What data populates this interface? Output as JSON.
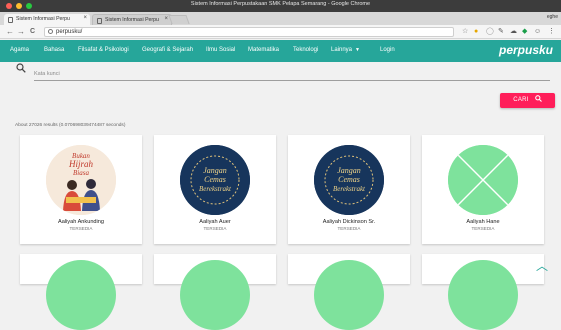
{
  "browser": {
    "window_title": "Sistem Informasi Perpustakaan SMK Pelapa Semarang - Google Chrome",
    "tabs": [
      {
        "label": "Sistem Informasi Perpu",
        "close": "×"
      },
      {
        "label": "Sistem Informasi Perpu",
        "close": "×"
      }
    ],
    "profile": "eghe",
    "url": "perpusku/",
    "back": "←",
    "forward": "→",
    "reload": "C"
  },
  "site": {
    "brand": "perpusku",
    "nav_items": [
      "Agama",
      "Bahasa",
      "Filsafat & Psikologi",
      "Geografi & Sejarah",
      "Ilmu Sosial",
      "Matematika",
      "Teknologi",
      "Lainnya",
      "Login"
    ]
  },
  "search": {
    "placeholder": "Kata kunci",
    "button_label": "CARI"
  },
  "results_info": "About 27026 results (0.070698039474487 seconds)",
  "books": [
    {
      "title": "Aaliyah Ankunding",
      "status": "TERSEDIA",
      "cover": "illustration-couple"
    },
    {
      "title": "Aaliyah Auer",
      "status": "TERSEDIA",
      "cover": "jangan-cemas"
    },
    {
      "title": "Aaliyah Dickinson Sr.",
      "status": "TERSEDIA",
      "cover": "jangan-cemas"
    },
    {
      "title": "Aaliyah Hane",
      "status": "TERSEDIA",
      "cover": "placeholder-x"
    }
  ],
  "covers": {
    "bukan_title": [
      "Bukan",
      "Hijrah",
      "Biasa"
    ],
    "jangan_title": [
      "Jangan",
      "Cemas",
      "Berekstrakt"
    ]
  },
  "colors": {
    "accent": "#26a69a",
    "button": "#ff1e5a",
    "placeholder_green": "#7ee29c",
    "cover_navy": "#17355c"
  }
}
